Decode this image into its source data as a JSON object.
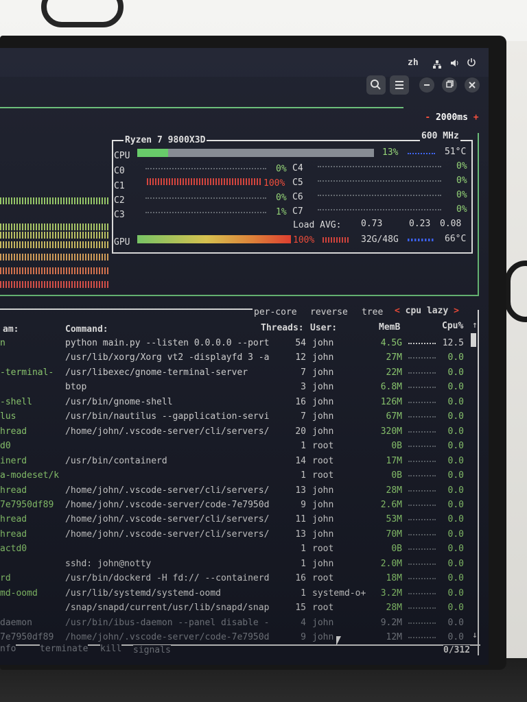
{
  "topbar": {
    "lang": "zh",
    "icons": [
      "network-icon",
      "volume-icon",
      "power-icon"
    ],
    "window_icons": [
      "search-icon",
      "menu-icon",
      "minimize-icon",
      "restore-icon",
      "close-icon"
    ]
  },
  "cpu_box": {
    "refresh": "- 2000ms +",
    "model": "Ryzen 7 9800X3D",
    "freq": "600 MHz",
    "cpu_label": "CPU",
    "cpu_pct": "13%",
    "cpu_temp": "51°C",
    "cpu_level": 0.13,
    "cores": [
      {
        "name": "C0",
        "pct": "0%"
      },
      {
        "name": "C1",
        "pct": "100%"
      },
      {
        "name": "C2",
        "pct": "0%"
      },
      {
        "name": "C3",
        "pct": "1%"
      },
      {
        "name": "C4",
        "pct": "0%"
      },
      {
        "name": "C5",
        "pct": "0%"
      },
      {
        "name": "C6",
        "pct": "0%"
      },
      {
        "name": "C7",
        "pct": "0%"
      }
    ],
    "load_label": "Load AVG:",
    "load1": "0.73",
    "load5": "0.23",
    "load15": "0.08",
    "gpu_label": "GPU",
    "gpu_pct": "100%",
    "gpu_mem": "32G/48G",
    "gpu_temp": "66°C",
    "gpu_level": 1.0
  },
  "proc_box": {
    "options": {
      "per_core": "per-core",
      "reverse": "reverse",
      "tree": "tree",
      "sort": "cpu lazy"
    },
    "headers": {
      "name": "am:",
      "command": "Command:",
      "threads": "Threads:",
      "user": "User:",
      "mem": "MemB",
      "cpu": "Cpu%"
    },
    "rows": [
      {
        "name": "n",
        "command": "python main.py --listen 0.0.0.0 --port",
        "threads": "54",
        "user": "john",
        "mem": "4.5G",
        "cpu": "12.5"
      },
      {
        "name": "",
        "command": "/usr/lib/xorg/Xorg vt2 -displayfd 3 -a",
        "threads": "12",
        "user": "john",
        "mem": "27M",
        "cpu": "0.0"
      },
      {
        "name": "-terminal-",
        "command": "/usr/libexec/gnome-terminal-server",
        "threads": "7",
        "user": "john",
        "mem": "22M",
        "cpu": "0.0"
      },
      {
        "name": "",
        "command": "btop",
        "threads": "3",
        "user": "john",
        "mem": "6.8M",
        "cpu": "0.0"
      },
      {
        "name": "-shell",
        "command": "/usr/bin/gnome-shell",
        "threads": "16",
        "user": "john",
        "mem": "126M",
        "cpu": "0.0"
      },
      {
        "name": "lus",
        "command": "/usr/bin/nautilus --gapplication-servi",
        "threads": "7",
        "user": "john",
        "mem": "67M",
        "cpu": "0.0"
      },
      {
        "name": "hread",
        "command": "/home/john/.vscode-server/cli/servers/",
        "threads": "20",
        "user": "john",
        "mem": "320M",
        "cpu": "0.0"
      },
      {
        "name": "d0",
        "command": "",
        "threads": "1",
        "user": "root",
        "mem": "0B",
        "cpu": "0.0"
      },
      {
        "name": "inerd",
        "command": "/usr/bin/containerd",
        "threads": "14",
        "user": "root",
        "mem": "17M",
        "cpu": "0.0"
      },
      {
        "name": "a-modeset/k",
        "command": "",
        "threads": "1",
        "user": "root",
        "mem": "0B",
        "cpu": "0.0"
      },
      {
        "name": "hread",
        "command": "/home/john/.vscode-server/cli/servers/",
        "threads": "13",
        "user": "john",
        "mem": "28M",
        "cpu": "0.0"
      },
      {
        "name": "7e7950df89",
        "command": "/home/john/.vscode-server/code-7e7950d",
        "threads": "9",
        "user": "john",
        "mem": "2.6M",
        "cpu": "0.0"
      },
      {
        "name": "hread",
        "command": "/home/john/.vscode-server/cli/servers/",
        "threads": "11",
        "user": "john",
        "mem": "53M",
        "cpu": "0.0"
      },
      {
        "name": "hread",
        "command": "/home/john/.vscode-server/cli/servers/",
        "threads": "13",
        "user": "john",
        "mem": "70M",
        "cpu": "0.0"
      },
      {
        "name": "actd0",
        "command": "",
        "threads": "1",
        "user": "root",
        "mem": "0B",
        "cpu": "0.0"
      },
      {
        "name": "",
        "command": "sshd: john@notty",
        "threads": "1",
        "user": "john",
        "mem": "2.0M",
        "cpu": "0.0"
      },
      {
        "name": "rd",
        "command": "/usr/bin/dockerd -H fd:// --containerd",
        "threads": "16",
        "user": "root",
        "mem": "18M",
        "cpu": "0.0"
      },
      {
        "name": "md-oomd",
        "command": "/usr/lib/systemd/systemd-oomd",
        "threads": "1",
        "user": "systemd-o+",
        "mem": "3.2M",
        "cpu": "0.0"
      },
      {
        "name": "",
        "command": "/snap/snapd/current/usr/lib/snapd/snap",
        "threads": "15",
        "user": "root",
        "mem": "28M",
        "cpu": "0.0"
      },
      {
        "name": "daemon",
        "command": "/usr/bin/ibus-daemon --panel disable -",
        "threads": "4",
        "user": "john",
        "mem": "9.2M",
        "cpu": "0.0"
      },
      {
        "name": "7e7950df89",
        "command": "/home/john/.vscode-server/code-7e7950d",
        "threads": "9",
        "user": "john",
        "mem": "12M",
        "cpu": "0.0"
      }
    ],
    "footer": {
      "info": "nfo",
      "terminate": "terminate",
      "kill": "kill",
      "signals": "signals",
      "count": "0/312"
    }
  }
}
